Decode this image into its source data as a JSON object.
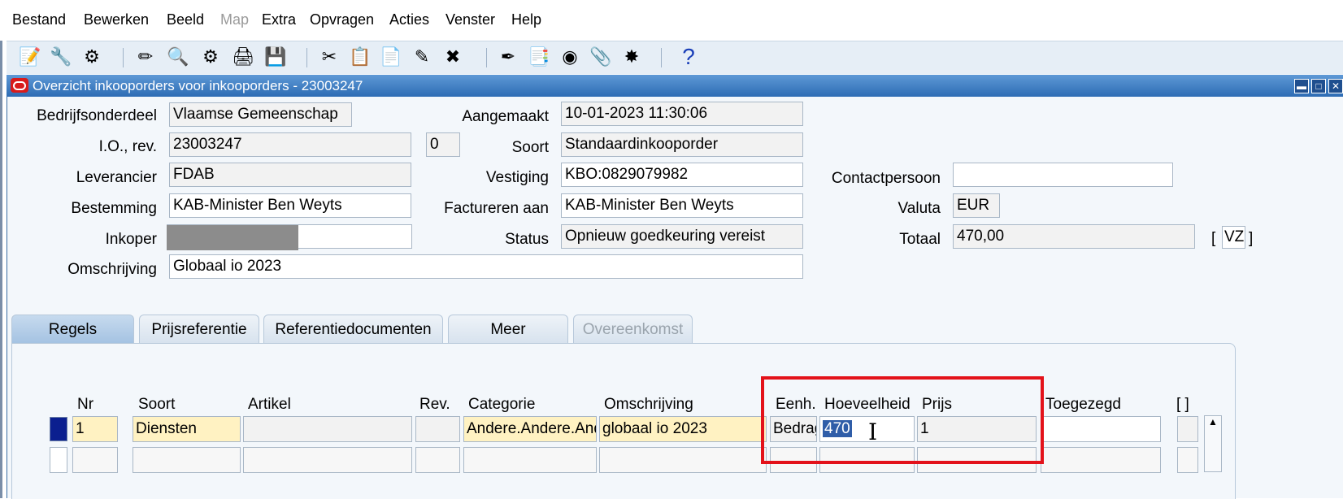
{
  "menu": [
    {
      "label": "Bestand",
      "disabled": false
    },
    {
      "label": "Bewerken",
      "disabled": false
    },
    {
      "label": "Beeld",
      "disabled": false
    },
    {
      "label": "Map",
      "disabled": true
    },
    {
      "label": "Extra",
      "disabled": false
    },
    {
      "label": "Opvragen",
      "disabled": false
    },
    {
      "label": "Acties",
      "disabled": false
    },
    {
      "label": "Venster",
      "disabled": false
    },
    {
      "label": "Help",
      "disabled": false
    }
  ],
  "toolbar": {
    "icons": [
      "new-record-icon",
      "tools-icon",
      "help-circle-icon",
      "edit-icon",
      "search-icon",
      "gear-icon",
      "print-icon",
      "save-icon",
      "cut-icon",
      "copy-icon",
      "paste-icon",
      "sign-icon",
      "clear-icon",
      "pen-icon",
      "form-icon",
      "globe-icon",
      "attach-icon",
      "magic-icon",
      "help-icon"
    ],
    "help_label": "?"
  },
  "window": {
    "title": "Overzicht inkooporders voor inkooporders - 23003247"
  },
  "header": {
    "bedrijfsonderdeel_label": "Bedrijfsonderdeel",
    "bedrijfsonderdeel": "Vlaamse Gemeenschap",
    "io_rev_label": "I.O., rev.",
    "io": "23003247",
    "rev": "0",
    "leverancier_label": "Leverancier",
    "leverancier": "FDAB",
    "bestemming_label": "Bestemming",
    "bestemming": "KAB-Minister Ben Weyts",
    "inkoper_label": "Inkoper",
    "inkoper": "",
    "omschrijving_label": "Omschrijving",
    "omschrijving": "Globaal io 2023",
    "aangemaakt_label": "Aangemaakt",
    "aangemaakt": "10-01-2023 11:30:06",
    "soort_label": "Soort",
    "soort": "Standaardinkooporder",
    "vestiging_label": "Vestiging",
    "vestiging": "KBO:0829079982",
    "factureren_label": "Factureren aan",
    "factureren": "KAB-Minister Ben Weyts",
    "status_label": "Status",
    "status": "Opnieuw goedkeuring vereist",
    "contactpersoon_label": "Contactpersoon",
    "contactpersoon": "",
    "valuta_label": "Valuta",
    "valuta": "EUR",
    "totaal_label": "Totaal",
    "totaal": "470,00",
    "vz_open": "[",
    "vz": "VZ",
    "vz_close": "]"
  },
  "tabs": [
    {
      "label": "Regels",
      "active": true,
      "disabled": false
    },
    {
      "label": "Prijsreferentie",
      "active": false,
      "disabled": false
    },
    {
      "label": "Referentiedocumenten",
      "active": false,
      "disabled": false
    },
    {
      "label": "Meer",
      "active": false,
      "disabled": false
    },
    {
      "label": "Overeenkomst",
      "active": false,
      "disabled": true
    }
  ],
  "lines": {
    "columns": [
      "Nr",
      "Soort",
      "Artikel",
      "Rev.",
      "Categorie",
      "Omschrijving",
      "Eenh.",
      "Hoeveelheid",
      "Prijs",
      "Toegezegd",
      "[ ]"
    ],
    "rows": [
      {
        "nr": "1",
        "soort": "Diensten",
        "artikel": "",
        "rev": "",
        "categorie": "Andere.Andere.Andere",
        "omschrijving": "globaal io 2023",
        "eenh": "Bedrag",
        "hoeveelheid": "470",
        "prijs": "1",
        "toegezegd": ""
      }
    ]
  },
  "colors": {
    "title_bar": "#2d6cb4",
    "highlight_box": "#e3121a",
    "required_field": "#fff2c2",
    "selection": "#2f5da8"
  }
}
